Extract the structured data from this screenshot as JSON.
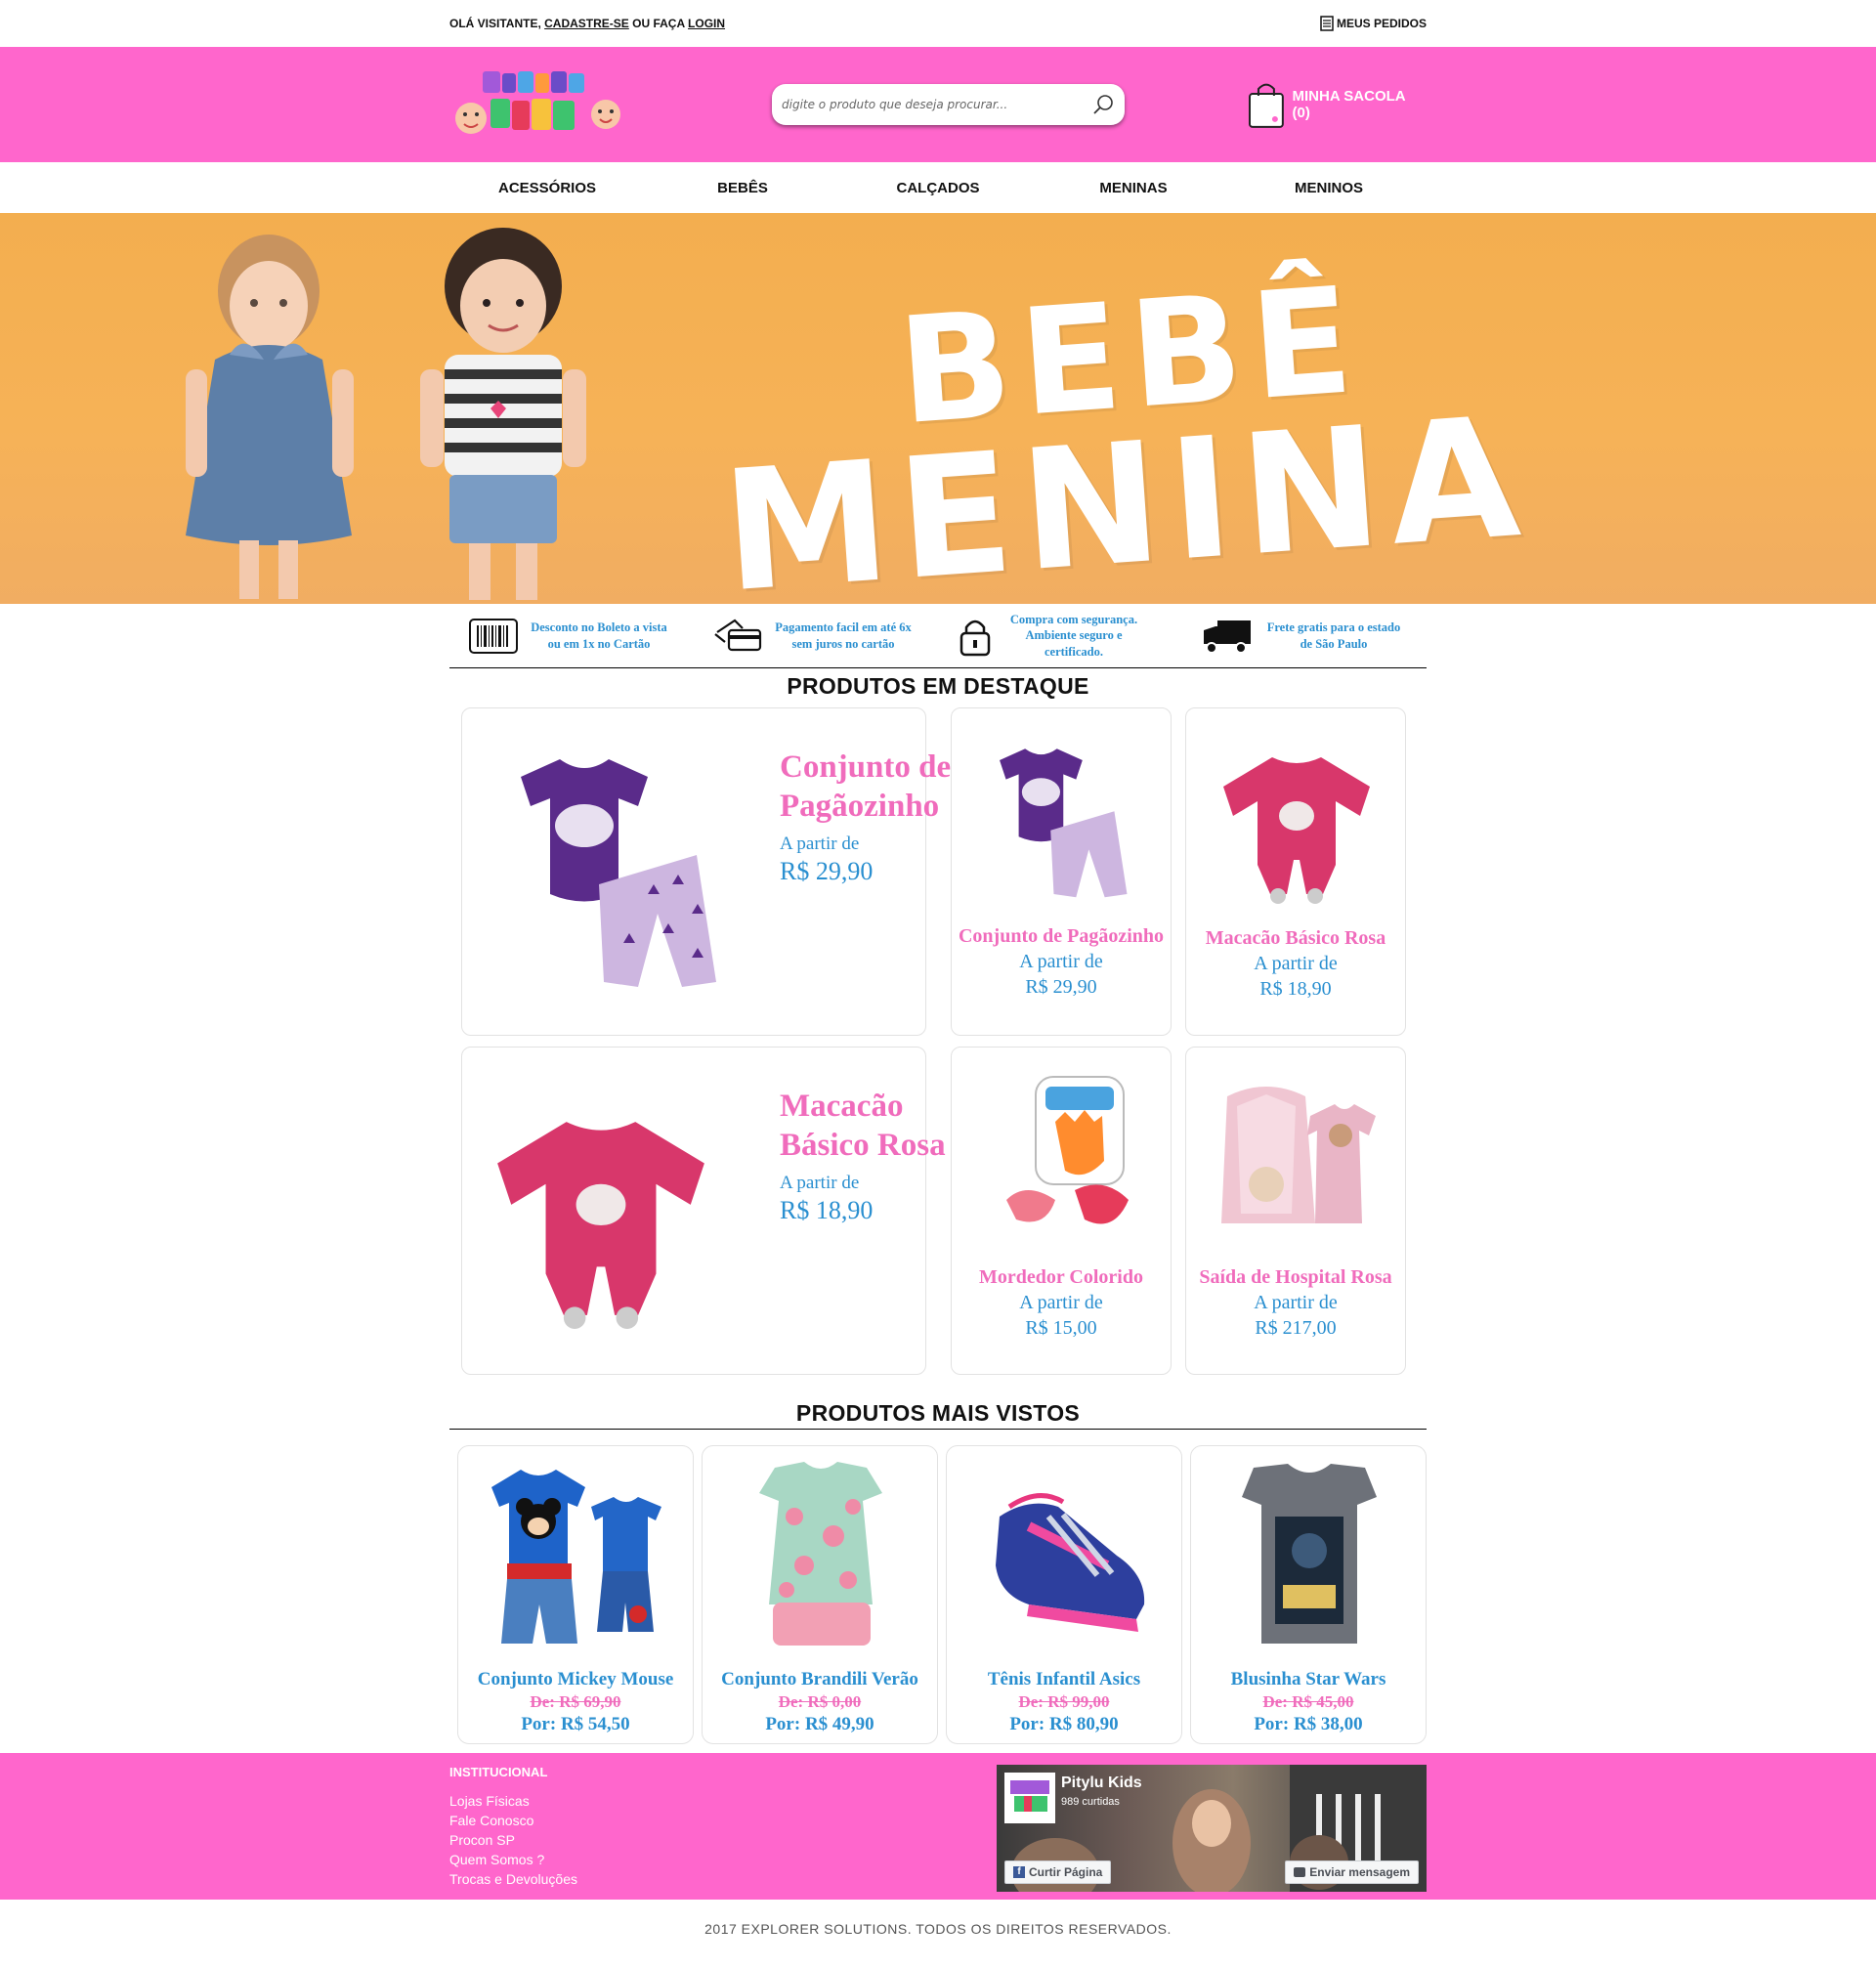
{
  "topbar": {
    "greeting": "OLÁ VISITANTE,",
    "register": "CADASTRE-SE",
    "or_do": "OU FAÇA",
    "login": "LOGIN",
    "my_orders": "MEUS PEDIDOS"
  },
  "header": {
    "logo_alt": "Pitylu Kids",
    "search_placeholder": "digite o produto que deseja procurar...",
    "cart_label": "MINHA SACOLA (0)"
  },
  "nav": {
    "items": [
      "ACESSÓRIOS",
      "BEBÊS",
      "CALÇADOS",
      "MENINAS",
      "MENINOS"
    ]
  },
  "banner": {
    "line1": "BEBÊ",
    "line2": "MENINA"
  },
  "benefits": [
    {
      "icon": "barcode-icon",
      "text": "Desconto no Boleto a vista ou em 1x no Cartão"
    },
    {
      "icon": "credit-card-icon",
      "text": "Pagamento facil em até 6x sem juros no cartão"
    },
    {
      "icon": "lock-icon",
      "text": "Compra com segurança. Ambiente seguro e certificado."
    },
    {
      "icon": "truck-icon",
      "text": "Frete gratis para o estado de São Paulo"
    }
  ],
  "featured": {
    "title": "PRODUTOS EM DESTAQUE",
    "big": [
      {
        "name": "Conjunto de Pagãozinho",
        "from": "A partir de",
        "price": "R$ 29,90"
      },
      {
        "name": "Macacão Básico Rosa",
        "from": "A partir de",
        "price": "R$ 18,90"
      }
    ],
    "small": [
      {
        "name": "Conjunto de Pagãozinho",
        "from": "A partir de",
        "price": "R$ 29,90"
      },
      {
        "name": "Macacão Básico Rosa",
        "from": "A partir de",
        "price": "R$ 18,90"
      },
      {
        "name": "Mordedor Colorido",
        "from": "A partir de",
        "price": "R$ 15,00"
      },
      {
        "name": "Saída de Hospital Rosa",
        "from": "A partir de",
        "price": "R$ 217,00"
      }
    ]
  },
  "most_viewed": {
    "title": "PRODUTOS MAIS VISTOS",
    "items": [
      {
        "name": "Conjunto Mickey Mouse",
        "old": "De: R$ 69,90",
        "new": "Por: R$ 54,50"
      },
      {
        "name": "Conjunto Brandili Verão",
        "old": "De: R$ 0,00",
        "new": "Por: R$ 49,90"
      },
      {
        "name": "Tênis Infantil Asics",
        "old": "De: R$ 99,00",
        "new": "Por: R$ 80,90"
      },
      {
        "name": "Blusinha Star Wars",
        "old": "De: R$ 45,00",
        "new": "Por: R$ 38,00"
      }
    ]
  },
  "footer": {
    "section_title": "INSTITUCIONAL",
    "links": [
      "Lojas Físicas",
      "Fale Conosco",
      "Procon SP",
      "Quem Somos ?",
      "Trocas e Devoluções"
    ],
    "facebook": {
      "page_name": "Pitylu Kids",
      "likes": "989 curtidas",
      "like_button": "Curtir Página",
      "message_button": "Enviar mensagem"
    }
  },
  "copyright": "2017 EXPLORER SOLUTIONS. TODOS OS DIREITOS RESERVADOS.",
  "colors": {
    "brand_pink": "#ff66cc",
    "product_pink": "#f06cbc",
    "price_blue": "#2a8fd0",
    "banner_orange": "#f4ad52"
  }
}
